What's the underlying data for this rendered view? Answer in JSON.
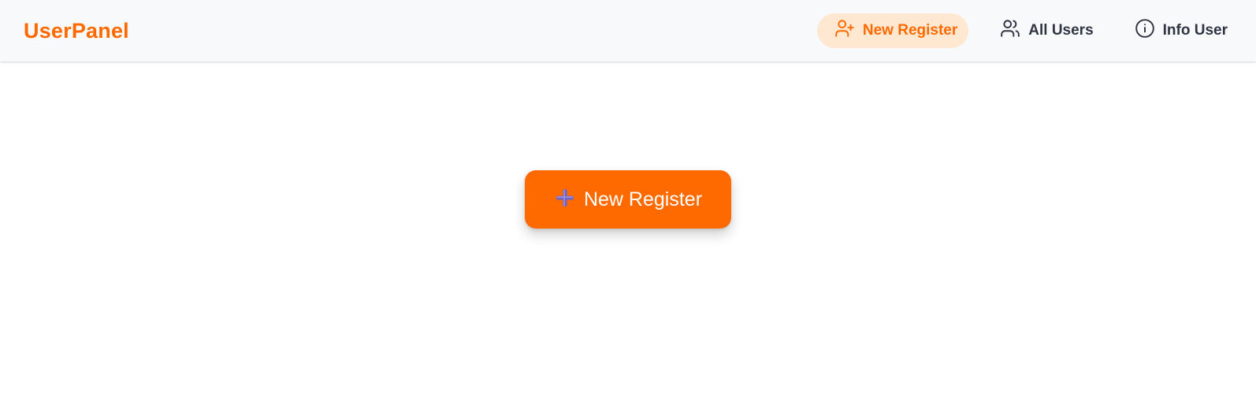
{
  "brand": {
    "title": "UserPanel"
  },
  "nav": {
    "items": [
      {
        "label": "New Register",
        "icon": "user-plus-icon",
        "active": true
      },
      {
        "label": "All Users",
        "icon": "users-icon",
        "active": false
      },
      {
        "label": "Info User",
        "icon": "info-icon",
        "active": false
      }
    ]
  },
  "main": {
    "button_label": "New Register",
    "button_icon": "plus-icon"
  },
  "colors": {
    "accent": "#ff6a00",
    "active_pill": "#ffe8d2",
    "nav_bg": "#f8f9fb",
    "text_dark": "#2f3542",
    "plus_icon": "#6f63c8"
  }
}
